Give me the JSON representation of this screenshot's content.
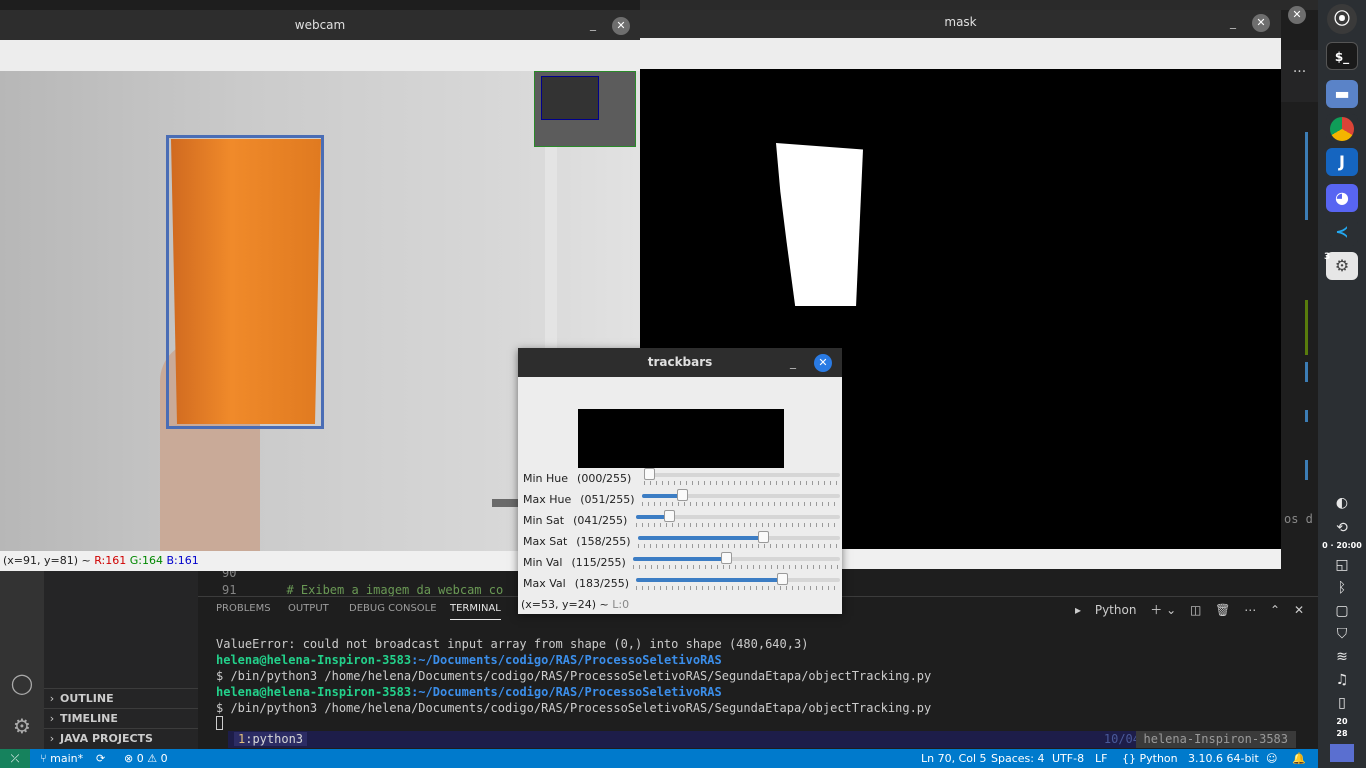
{
  "windows": {
    "webcam": {
      "title": "webcam",
      "status": {
        "coords": "(x=91, y=81) ~",
        "r": "R:161",
        "g": "G:164",
        "b": "B:161"
      }
    },
    "mask": {
      "title": "mask"
    },
    "trackbars": {
      "title": "trackbars",
      "sliders": [
        {
          "label": "Min Hue",
          "value": "(000/255)",
          "fraction": 0.0
        },
        {
          "label": "Max Hue",
          "value": "(051/255)",
          "fraction": 0.2
        },
        {
          "label": "Min Sat",
          "value": "(041/255)",
          "fraction": 0.161
        },
        {
          "label": "Max Sat",
          "value": "(158/255)",
          "fraction": 0.62
        },
        {
          "label": "Min Val",
          "value": "(115/255)",
          "fraction": 0.451
        },
        {
          "label": "Max Val",
          "value": "(183/255)",
          "fraction": 0.718
        }
      ],
      "status": "(x=53, y=24) ~",
      "status_level": "L:0"
    }
  },
  "editor": {
    "line_numbers": [
      "90",
      "91"
    ],
    "comment": "# Exibem a imagem da webcam co",
    "right_fragment": "os d",
    "more_actions": "..."
  },
  "sidebar": {
    "sections": [
      "OUTLINE",
      "TIMELINE",
      "JAVA PROJECTS"
    ]
  },
  "panel": {
    "tabs": [
      "PROBLEMS",
      "OUTPUT",
      "DEBUG CONSOLE",
      "TERMINAL"
    ],
    "active_tab": "TERMINAL",
    "shell": "Python",
    "terminal": {
      "error": "ValueError: could not broadcast input array from shape (0,) into shape (480,640,3)",
      "user_host": "helena@helena-Inspiron-3583",
      "path": ":~/Documents/codigo/RAS/ProcessoSeletivoRAS",
      "command": "$ /bin/python3 /home/helena/Documents/codigo/RAS/ProcessoSeletivoRAS/SegundaEtapa/objectTracking.py"
    },
    "tmux": {
      "window_num": "1",
      "window_name": ":python3",
      "date": "10/04",
      "host": "helena-Inspiron-3583"
    }
  },
  "statusbar": {
    "branch": "main*",
    "problems": "⊗ 0 ⚠ 0",
    "position": "Ln 70, Col 5",
    "spaces": "Spaces: 4",
    "encoding": "UTF-8",
    "eol": "LF",
    "language": "Python",
    "interpreter": "3.10.6 64-bit"
  },
  "dock": {
    "badge": "3",
    "date_time": "0 · 20:00",
    "clock_hour": "20",
    "clock_min": "28"
  },
  "colors": {
    "bbox": "#4a6db5",
    "vscode_blue": "#007acc",
    "terminal_green": "#23d18b",
    "terminal_blue": "#3b8eea"
  }
}
